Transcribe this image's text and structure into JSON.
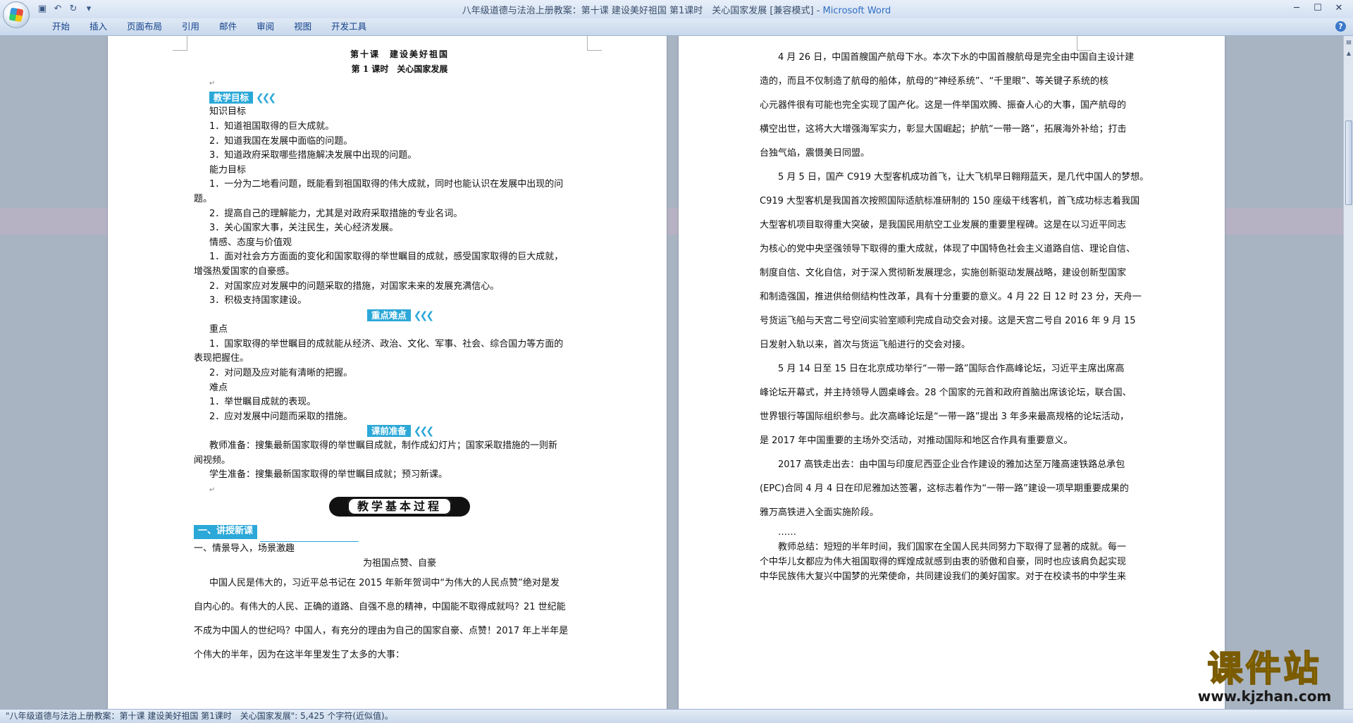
{
  "window": {
    "title": "八年级道德与法治上册教案：第十课 建设美好祖国 第1课时　关心国家发展 [兼容模式] - ",
    "app_name": "Microsoft Word"
  },
  "ribbon": {
    "tabs": [
      "开始",
      "插入",
      "页面布局",
      "引用",
      "邮件",
      "审阅",
      "视图",
      "开发工具"
    ]
  },
  "page1": {
    "lesson_title": "第十课　建设美好祖国",
    "lesson_subtitle": "第 1 课时　关心国家发展",
    "section_goals": "教学目标",
    "knowledge_goal": "知识目标",
    "k1": "1．知道祖国取得的巨大成就。",
    "k2": "2．知道我国在发展中面临的问题。",
    "k3": "3．知道政府采取哪些措施解决发展中出现的问题。",
    "ability_goal": "能力目标",
    "a1a": "1．一分为二地看问题，既能看到祖国取得的伟大成就，同时也能认识在发展中出现的问",
    "a1b": "题。",
    "a2": "2．提高自己的理解能力，尤其是对政府采取措施的专业名词。",
    "a3": "3．关心国家大事，关注民生，关心经济发展。",
    "emotion_goal": "情感、态度与价值观",
    "e1a": "1．面对社会方方面面的变化和国家取得的举世瞩目的成就，感受国家取得的巨大成就，",
    "e1b": "增强热爱国家的自豪感。",
    "e2": "2．对国家应对发展中的问题采取的措施，对国家未来的发展充满信心。",
    "e3": "3．积极支持国家建设。",
    "section_keys": "重点难点",
    "key_label": "重点",
    "key1a": "1．国家取得的举世瞩目的成就能从经济、政治、文化、军事、社会、综合国力等方面的",
    "key1b": "表现把握住。",
    "key2": "2．对问题及应对能有清晰的把握。",
    "diff_label": "难点",
    "d1": "1．举世瞩目成就的表现。",
    "d2": "2．应对发展中问题而采取的措施。",
    "section_prep": "课前准备",
    "prep_t1": "教师准备：搜集最新国家取得的举世瞩目成就，制作成幻灯片；国家采取措施的一则新",
    "prep_t2": "闻视频。",
    "prep_s": "学生准备：搜集最新国家取得的举世瞩目成就；预习新课。",
    "process_banner": "教学基本过程",
    "section_new": "一、讲授新课",
    "step1": "一、情景导入，场景激趣",
    "step1_title": "为祖国点赞、自豪",
    "para1": "中国人民是伟大的，习近平总书记在 2015 年新年贺词中“为伟大的人民点赞”绝对是发",
    "para2": "自内心的。有伟大的人民、正确的道路、自强不息的精神，中国能不取得成就吗？21 世纪能",
    "para3": "不成为中国人的世纪吗？中国人，有充分的理由为自己的国家自豪、点赞！2017 年上半年是",
    "para4": "个伟大的半年，因为在这半年里发生了太多的大事："
  },
  "page2": {
    "l1": "4 月 26 日，中国首艘国产航母下水。本次下水的中国首艘航母是完全由中国自主设计建",
    "l2": "造的，而且不仅制造了航母的船体，航母的“神经系统”、“千里眼”、等关键子系统的核",
    "l3": "心元器件很有可能也完全实现了国产化。这是一件举国欢腾、振奋人心的大事，国产航母的",
    "l4": "横空出世，这将大大增强海军实力，彰显大国崛起；护航“一带一路”，拓展海外补给；打击",
    "l5": "台独气焰，震慑美日同盟。",
    "l6": "5 月 5 日，国产 C919 大型客机成功首飞，让大飞机早日翱翔蓝天，是几代中国人的梦想。",
    "l7": "C919 大型客机是我国首次按照国际适航标准研制的 150 座级干线客机，首飞成功标志着我国",
    "l8": "大型客机项目取得重大突破，是我国民用航空工业发展的重要里程碑。这是在以习近平同志",
    "l9": "为核心的党中央坚强领导下取得的重大成就，体现了中国特色社会主义道路自信、理论自信、",
    "l10": "制度自信、文化自信，对于深入贯彻新发展理念，实施创新驱动发展战略，建设创新型国家",
    "l11": "和制造强国，推进供给侧结构性改革，具有十分重要的意义。4 月 22 日 12 时 23 分，天舟一",
    "l12": "号货运飞船与天宫二号空间实验室顺利完成自动交会对接。这是天宫二号自 2016 年 9 月 15",
    "l13": "日发射入轨以来，首次与货运飞船进行的交会对接。",
    "l14": "5 月 14 日至 15 日在北京成功举行“一带一路”国际合作高峰论坛，习近平主席出席高",
    "l15": "峰论坛开幕式，并主持领导人圆桌峰会。28 个国家的元首和政府首脑出席该论坛，联合国、",
    "l16": "世界银行等国际组织参与。此次高峰论坛是“一带一路”提出 3 年多来最高规格的论坛活动，",
    "l17": "是 2017 年中国重要的主场外交活动，对推动国际和地区合作具有重要意义。",
    "l18": "2017 高铁走出去：由中国与印度尼西亚企业合作建设的雅加达至万隆高速铁路总承包",
    "l19": "(EPC)合同 4 月 4 日在印尼雅加达签署，这标志着作为“一带一路”建设一项早期重要成果的",
    "l20": "雅万高铁进入全面实施阶段。",
    "l21": "……",
    "l22": "教师总结：短短的半年时间，我们国家在全国人民共同努力下取得了显著的成就。每一",
    "l23": "个中华儿女都应为伟大祖国取得的辉煌成就感到由衷的骄傲和自豪，同时也应该肩负起实现",
    "l24": "中华民族伟大复兴中国梦的光荣使命，共同建设我们的美好国家。对于在校读书的中学生来"
  },
  "statusbar": {
    "text": "\"八年级道德与法治上册教案：第十课 建设美好祖国 第1课时　关心国家发展\": 5,425 个字符(近似值)。"
  },
  "watermark": {
    "cn": "课件站",
    "url": "www.kjzhan.com"
  }
}
